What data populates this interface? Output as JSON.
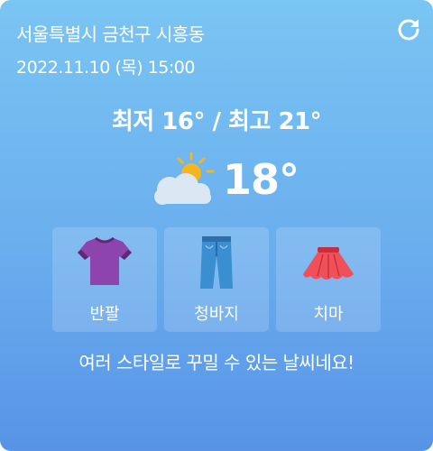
{
  "header": {
    "location": "서울특별시 금천구 시흥동",
    "datetime": "2022.11.10 (목) 15:00",
    "refresh_icon": "refresh-icon"
  },
  "weather": {
    "minmax": "최저 16° / 최고 21°",
    "current_temp": "18°",
    "condition_icon": "partly-cloudy-icon"
  },
  "outfits": [
    {
      "label": "반팔",
      "icon": "tshirt-icon"
    },
    {
      "label": "청바지",
      "icon": "jeans-icon"
    },
    {
      "label": "치마",
      "icon": "skirt-icon"
    }
  ],
  "message": "여러 스타일로 꾸밀 수 있는 날씨네요!",
  "colors": {
    "background_top": "#79c5f3",
    "background_bottom": "#5893e6",
    "tshirt": "#8e44ad",
    "jeans": "#3a8fd1",
    "skirt": "#f0505a",
    "sun": "#f5b51e"
  }
}
